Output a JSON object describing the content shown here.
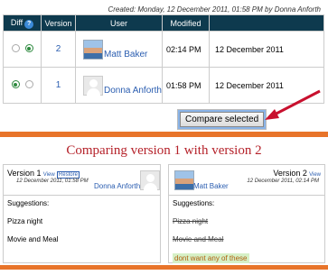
{
  "created": "Created: Monday, 12 December 2011, 01:58 PM by Donna Anforth",
  "table": {
    "headers": [
      "Diff",
      "Version",
      "User",
      "Modified",
      ""
    ],
    "rows": [
      {
        "version": "2",
        "user": "Matt Baker",
        "time": "02:14 PM",
        "date": "12 December 2011"
      },
      {
        "version": "1",
        "user": "Donna Anforth",
        "time": "01:58 PM",
        "date": "12 December 2011"
      }
    ]
  },
  "compare_label": "Compare selected",
  "heading": "Comparing version 1 with version 2",
  "left": {
    "title": "Version 1",
    "view": "View",
    "restore": "Restore",
    "date": "12 December 2011, 01:58 PM",
    "user": "Donna Anforth",
    "lines": [
      "Suggestions:",
      "Pizza night",
      "Movie and Meal"
    ]
  },
  "right": {
    "title": "Version 2",
    "view": "View",
    "date": "12 December 2011, 02:14 PM",
    "user": "Matt Baker",
    "lines": [
      "Suggestions:",
      "Pizza night",
      "Movie and Meal",
      "dont want any of these"
    ]
  },
  "colors": {
    "header_bg": "#0e3a4e",
    "link": "#2a5db0",
    "accent": "#e8742a",
    "heading": "#b5222a",
    "arrow": "#c8102e"
  }
}
